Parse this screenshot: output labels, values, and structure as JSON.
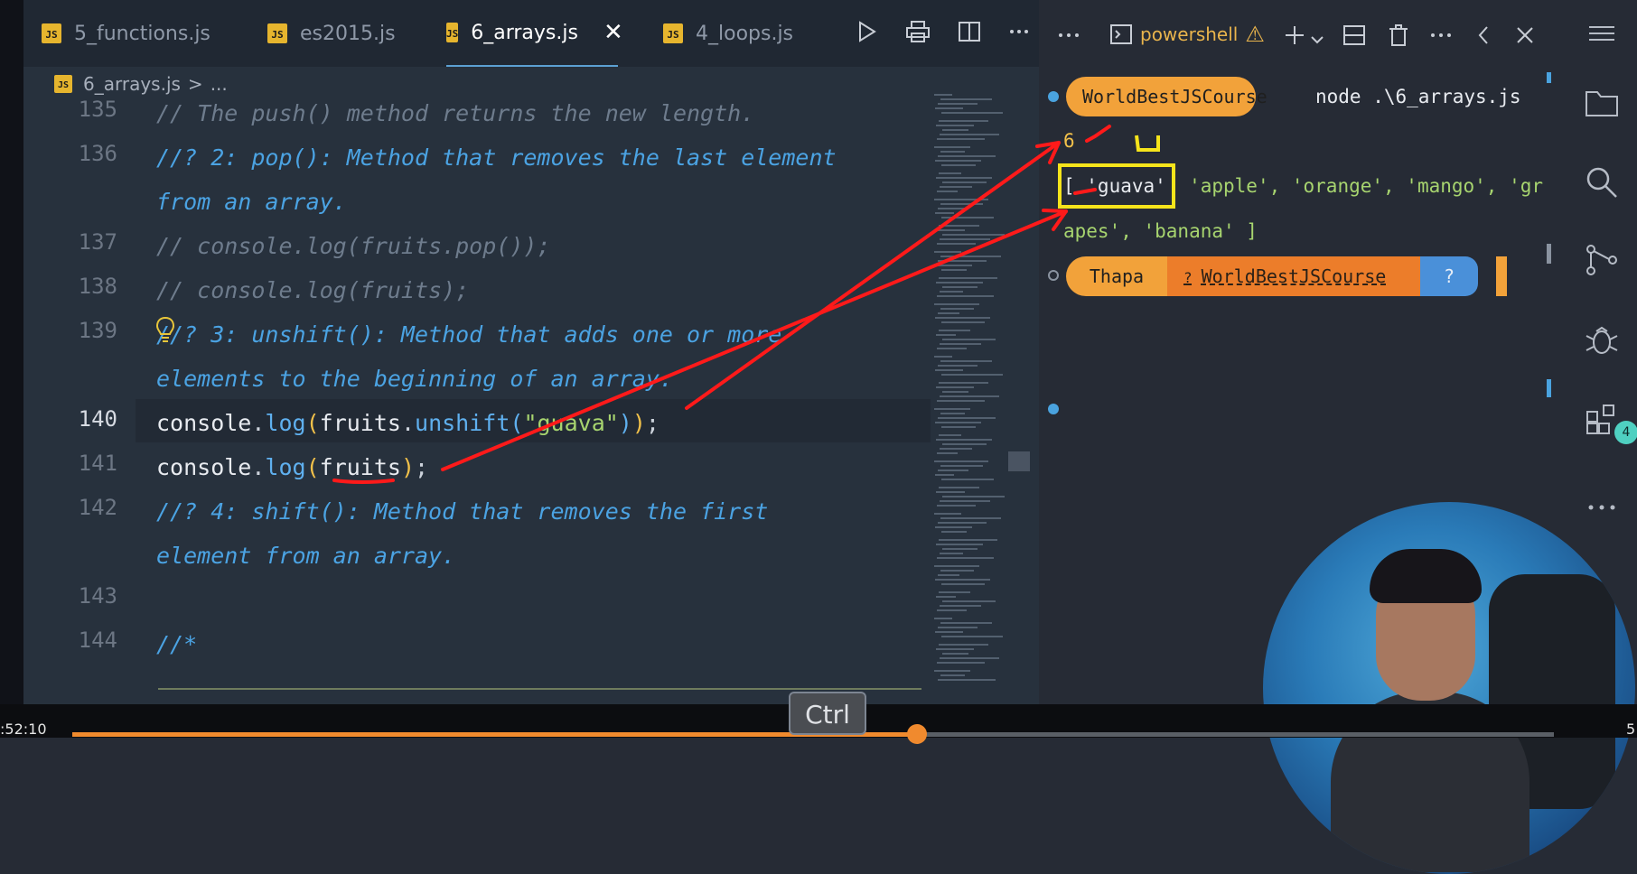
{
  "tabs": [
    {
      "label": "5_functions.js",
      "active": false
    },
    {
      "label": "es2015.js",
      "active": false
    },
    {
      "label": "6_arrays.js",
      "active": true
    },
    {
      "label": "4_loops.js",
      "active": false
    }
  ],
  "tab_badge": "JS",
  "tab_close_glyph": "✕",
  "breadcrumb": {
    "file": "6_arrays.js",
    "separator": ">",
    "rest": "..."
  },
  "editor": {
    "line_numbers": [
      "135",
      "136",
      "137",
      "138",
      "139",
      "140",
      "141",
      "142",
      "143",
      "144"
    ],
    "comment_135": "// The push() method returns the new length.",
    "comment_136a": "//? 2: pop(): Method that removes the last element",
    "comment_136b": "from an array.",
    "comment_137": "// console.log(fruits.pop());",
    "comment_138": "// console.log(fruits);",
    "comment_139a": "//? 3: unshift(): Method that adds one or more",
    "comment_139b": "elements to the beginning of an array.",
    "line_140": {
      "obj": "console",
      "dot1": ".",
      "fn": "log",
      "open": "(",
      "arr": "fruits",
      "dot2": ".",
      "method": "unshift",
      "open2": "(",
      "str": "\"guava\"",
      "close2": ")",
      "close": ")",
      "semi": ";"
    },
    "line_141": {
      "obj": "console",
      "dot1": ".",
      "fn": "log",
      "open": "(",
      "arr": "fruits",
      "close": ")",
      "semi": ";"
    },
    "comment_142a": "//? 4: shift(): Method that removes the first",
    "comment_142b": "element from an array.",
    "comment_144": "//*"
  },
  "terminal": {
    "shell_label": "powershell",
    "warning_glyph": "⚠",
    "prompt_dir": "WorldBestJSCourse",
    "command": "node .\\6_arrays.js",
    "output_length": "6",
    "output_array_line1_start": "[ 'guava'",
    "output_array_line1_rest": "  'apple', 'orange', 'mango', 'gr",
    "output_array_line2": "apes', 'banana' ]",
    "prompt2_user": "Thapa",
    "prompt2_dir": "WorldBestJSCourse",
    "prompt2_extra": "?",
    "prompt2_dir_icon": "?"
  },
  "activity_badge": "4",
  "keyboard_hint": "Ctrl",
  "video": {
    "time_current": ":52:10",
    "time_end": "5",
    "progress_fraction": 0.57
  },
  "colors": {
    "accent_orange": "#f08a2e",
    "annotation_red": "#ff1a1a",
    "highlight_yellow": "#f5e41b",
    "prompt_orange": "#f2a23a"
  },
  "icons": [
    "run-icon",
    "print-icon",
    "split-icon",
    "more-icon",
    "terminal-icon",
    "plus-icon",
    "chevron-down-icon",
    "layout-icon",
    "trash-icon",
    "chevron-left-icon",
    "close-icon",
    "menu-icon",
    "files-icon",
    "search-icon",
    "source-control-icon",
    "debug-icon",
    "extensions-icon",
    "lightbulb-icon"
  ]
}
